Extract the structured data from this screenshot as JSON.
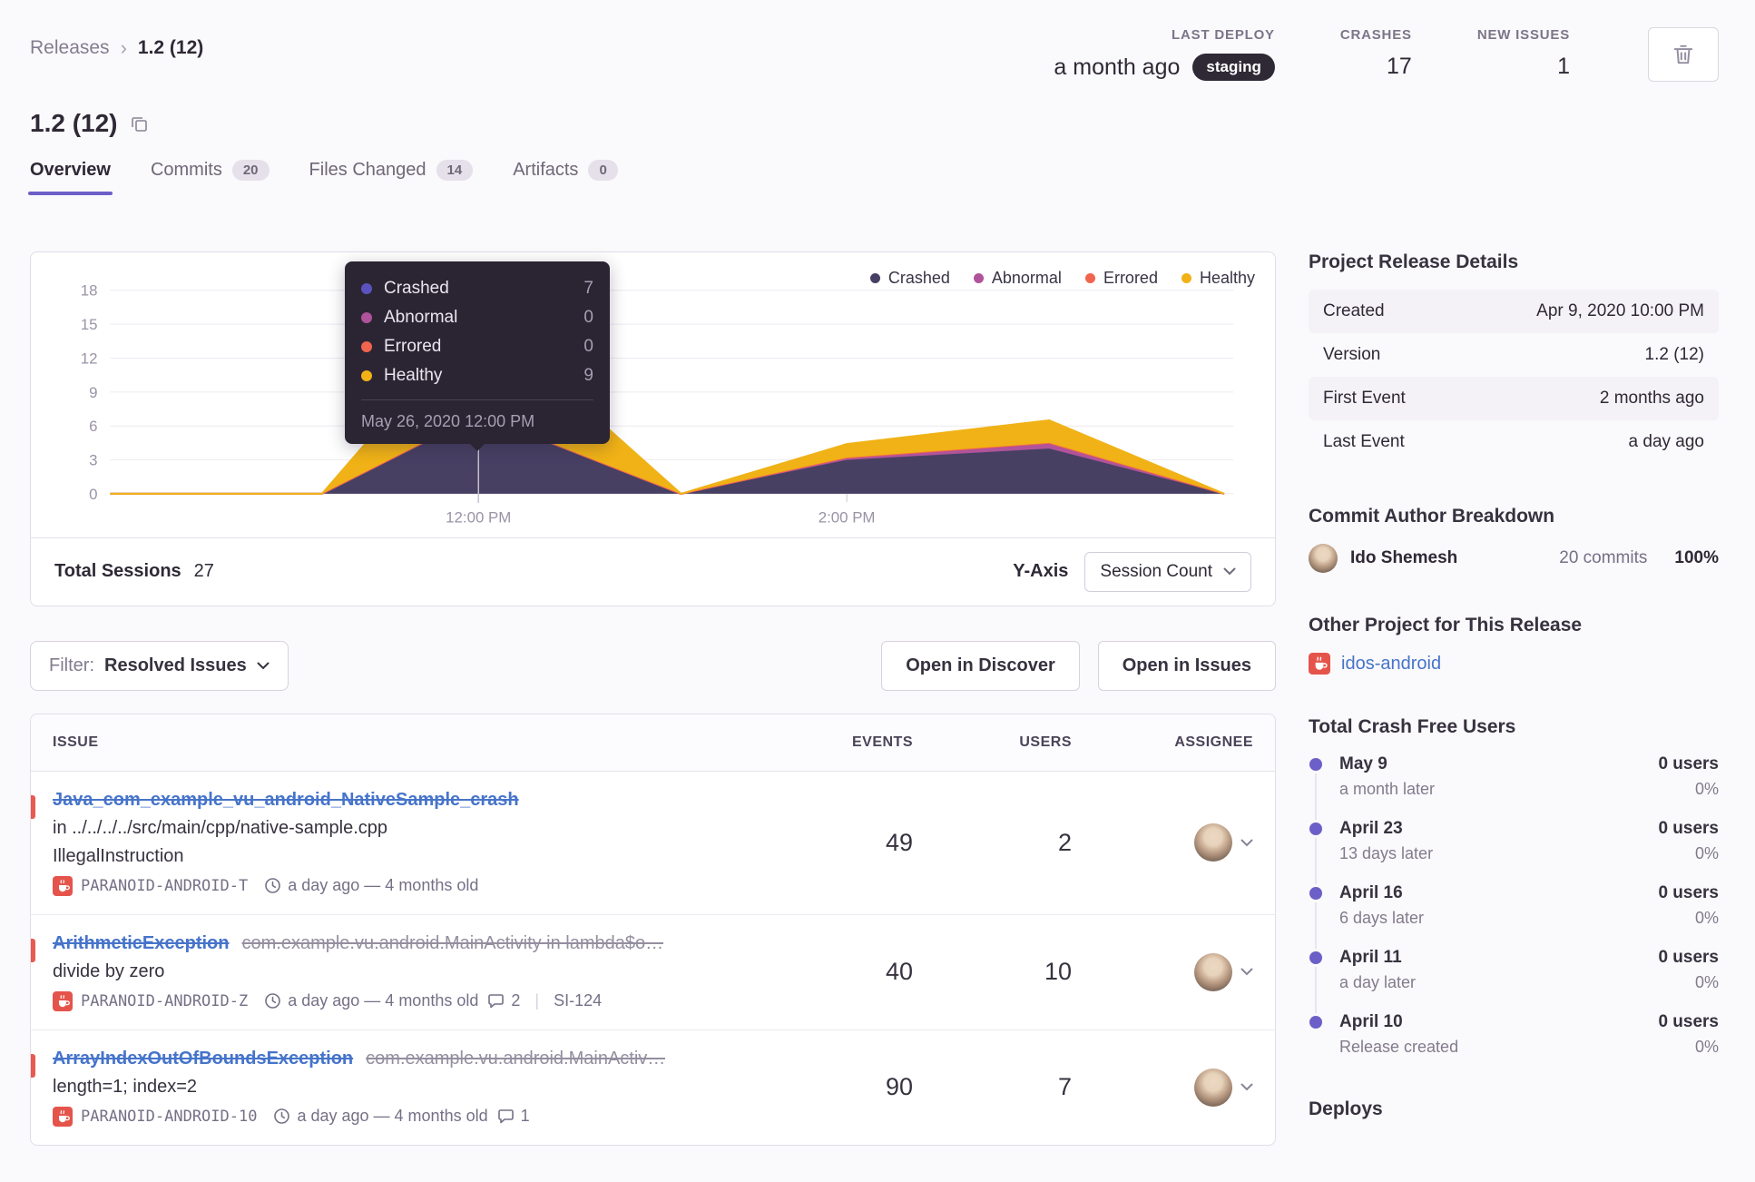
{
  "breadcrumb": {
    "parent": "Releases",
    "separator": "›",
    "current": "1.2 (12)"
  },
  "top_stats": {
    "last_deploy": {
      "label": "LAST DEPLOY",
      "value": "a month ago",
      "badge": "staging"
    },
    "crashes": {
      "label": "CRASHES",
      "value": "17"
    },
    "new_issues": {
      "label": "NEW ISSUES",
      "value": "1"
    }
  },
  "header": {
    "title": "1.2 (12)"
  },
  "tabs": [
    {
      "label": "Overview"
    },
    {
      "label": "Commits",
      "badge": "20"
    },
    {
      "label": "Files Changed",
      "badge": "14"
    },
    {
      "label": "Artifacts",
      "badge": "0"
    }
  ],
  "chart_data": {
    "type": "area",
    "stacked": true,
    "title": "Release sessions over time",
    "x_unit": "hour_of_day",
    "x_range": [
      10,
      16.1
    ],
    "x": [
      10,
      11.15,
      12,
      13.1,
      14,
      15.1,
      16.05
    ],
    "series": [
      {
        "name": "Crashed",
        "color": "#474063",
        "values": [
          0,
          0,
          7,
          0,
          3,
          4,
          0
        ]
      },
      {
        "name": "Abnormal",
        "color": "#b0539a",
        "values": [
          0,
          0,
          0,
          0,
          0.2,
          0.5,
          0
        ]
      },
      {
        "name": "Errored",
        "color": "#f1644d",
        "values": [
          0,
          0,
          0,
          0,
          0,
          0,
          0
        ]
      },
      {
        "name": "Healthy",
        "color": "#f0b216",
        "values": [
          0,
          0,
          9,
          0,
          1.2,
          2,
          0
        ]
      }
    ],
    "ylim": [
      0,
      18
    ],
    "ytick_step": 3,
    "xticks": [
      {
        "t": 12,
        "label": "12:00 PM"
      },
      {
        "t": 14,
        "label": "2:00 PM"
      }
    ],
    "tooltip_x": 12,
    "legend_position": "top-right",
    "grid": true
  },
  "chart_tooltip": {
    "rows": [
      {
        "name": "Crashed",
        "value": "7",
        "color": "#5b52c0"
      },
      {
        "name": "Abnormal",
        "value": "0",
        "color": "#b0539a"
      },
      {
        "name": "Errored",
        "value": "0",
        "color": "#f1644d"
      },
      {
        "name": "Healthy",
        "value": "9",
        "color": "#f0b216"
      }
    ],
    "timestamp": "May 26, 2020 12:00 PM"
  },
  "chart_footer": {
    "total_label": "Total Sessions",
    "total_value": "27",
    "yaxis_label": "Y-Axis",
    "yaxis_value": "Session Count"
  },
  "filter_bar": {
    "filter_label": "Filter:",
    "filter_value": "Resolved Issues",
    "open_in_discover": "Open in Discover",
    "open_in_issues": "Open in Issues"
  },
  "issues_table": {
    "columns": {
      "issue": "ISSUE",
      "events": "EVENTS",
      "users": "USERS",
      "assignee": "ASSIGNEE"
    },
    "rows": [
      {
        "title": "Java_com_example_vu_android_NativeSample_crash",
        "line2": "in ../../../../src/main/cpp/native-sample.cpp",
        "line3": "IllegalInstruction",
        "project": "PARANOID-ANDROID-T",
        "age": "a day ago — 4 months old",
        "events": "49",
        "users": "2"
      },
      {
        "title": "ArithmeticException",
        "culprit": "com.example.vu.android.MainActivity in lambda$o…",
        "line2": "divide by zero",
        "project": "PARANOID-ANDROID-Z",
        "age": "a day ago — 4 months old",
        "comments": "2",
        "annotation": "SI-124",
        "events": "40",
        "users": "10"
      },
      {
        "title": "ArrayIndexOutOfBoundsException",
        "culprit": "com.example.vu.android.MainActiv…",
        "line2": "length=1; index=2",
        "project": "PARANOID-ANDROID-10",
        "age": "a day ago — 4 months old",
        "comments": "1",
        "events": "90",
        "users": "7"
      }
    ]
  },
  "sidebar": {
    "release_details": {
      "heading": "Project Release Details",
      "rows": [
        {
          "label": "Created",
          "value": "Apr 9, 2020 10:00 PM"
        },
        {
          "label": "Version",
          "value": "1.2 (12)"
        },
        {
          "label": "First Event",
          "value": "2 months ago"
        },
        {
          "label": "Last Event",
          "value": "a day ago"
        }
      ]
    },
    "commit_authors": {
      "heading": "Commit Author Breakdown",
      "author": {
        "name": "Ido Shemesh",
        "commits": "20 commits",
        "percent": "100%"
      }
    },
    "other_projects": {
      "heading": "Other Project for This Release",
      "project": "idos-android"
    },
    "crash_free": {
      "heading": "Total Crash Free Users",
      "entries": [
        {
          "date": "May 9",
          "sub": "a month later",
          "users": "0 users",
          "percent": "0%"
        },
        {
          "date": "April 23",
          "sub": "13 days later",
          "users": "0 users",
          "percent": "0%"
        },
        {
          "date": "April 16",
          "sub": "6 days later",
          "users": "0 users",
          "percent": "0%"
        },
        {
          "date": "April 11",
          "sub": "a day later",
          "users": "0 users",
          "percent": "0%"
        },
        {
          "date": "April 10",
          "sub": "Release created",
          "users": "0 users",
          "percent": "0%"
        }
      ]
    },
    "deploys": {
      "heading": "Deploys"
    }
  },
  "colors": {
    "accent": "#6c5fc7",
    "link": "#4674ca",
    "danger": "#e8594f",
    "env_badge_bg": "#2f2936"
  }
}
